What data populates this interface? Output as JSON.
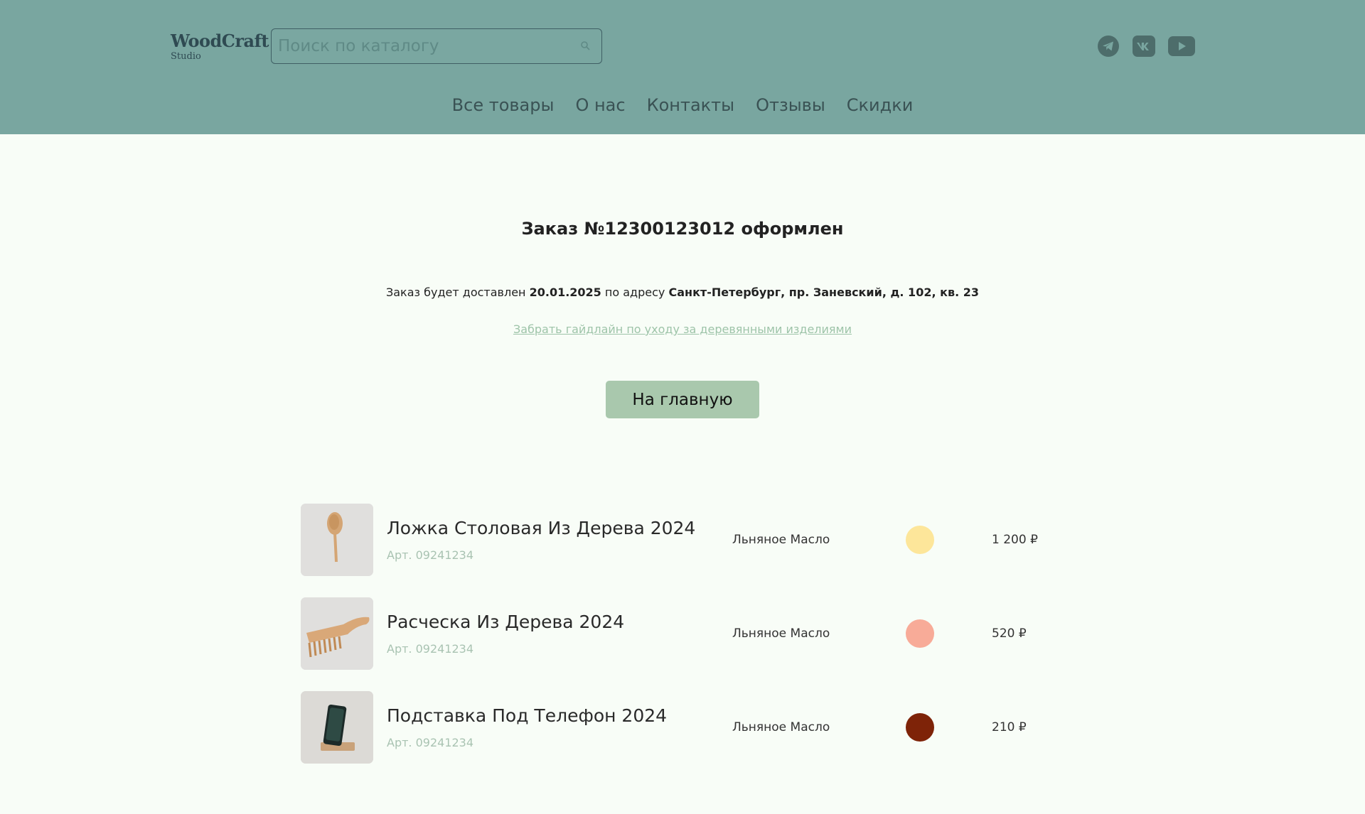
{
  "header": {
    "logo_main": "WoodCraft",
    "logo_sub": "Studio",
    "search_placeholder": "Поиск по каталогу",
    "search_icon": "search-icon",
    "socials": [
      "telegram-icon",
      "vk-icon",
      "youtube-icon"
    ],
    "colors": {
      "background": "#79a6a0",
      "text": "#3a5254"
    }
  },
  "nav": {
    "items": [
      "Все товары",
      "О нас",
      "Контакты",
      "Отзывы",
      "Скидки"
    ]
  },
  "order": {
    "title": "Заказ №12300123012 оформлен",
    "delivery_prefix": "Заказ будет доставлен",
    "delivery_date": "20.01.2025",
    "delivery_mid": "по адресу",
    "delivery_address": "Санкт-Петербург, пр. Заневский, д. 102, кв. 23",
    "guide_link": "Забрать гайдлайн по уходу за деревянными изделиями",
    "home_button": "На главную"
  },
  "items": [
    {
      "name": "Ложка Столовая Из Дерева 2024",
      "article": "Арт. 09241234",
      "finish": "Льняное Масло",
      "color": "#fde69a",
      "price": "1 200 ₽",
      "image": "spoon"
    },
    {
      "name": "Расческа Из Дерева 2024",
      "article": "Арт. 09241234",
      "finish": "Льняное Масло",
      "color": "#f8ab98",
      "price": "520 ₽",
      "image": "comb"
    },
    {
      "name": "Подставка Под Телефон 2024",
      "article": "Арт. 09241234",
      "finish": "Льняное Масло",
      "color": "#7e2308",
      "price": "210 ₽",
      "image": "phone-stand"
    }
  ]
}
